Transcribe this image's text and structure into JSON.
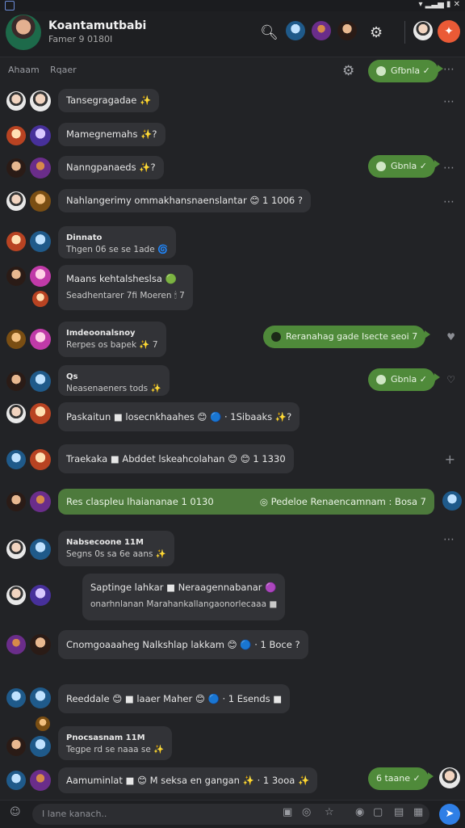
{
  "status": {
    "right": "▾ ▂▃▅ ▮ ✕"
  },
  "header": {
    "title": "Koantamutbabi",
    "subtitle": "Famer 9 0180I",
    "cta_icon": "ghost-icon"
  },
  "toolbar": {
    "left_label": "Ahaam",
    "right_label": "Rqaer"
  },
  "pill_top": {
    "label": "Gfbnla ✓"
  },
  "messages": [
    {
      "text": "Tansegragadae ✨"
    },
    {
      "text": "Mamegnemahs ✨?"
    },
    {
      "text": "Nanngpanaeds ✨?",
      "reply": "Gbnla ✓"
    },
    {
      "text": "Nahlangerimy ommakhansnaenslantar 😊 1 1006 ?"
    },
    {
      "top": "Dinnato",
      "sub": "Thgen 06 se se 1ade 🌀"
    },
    {
      "text": "Maans kehtalsheslsa 🟢",
      "sub": "Seadhentarer 7fi Moeren 🕯 7"
    },
    {
      "top": "Imdeoonalsnoy",
      "sub": "Rerpes os bapek ✨ 7",
      "reply": "Reranahag gade Isecte seoi 7"
    },
    {
      "top": "Qs",
      "sub": "Neasenaeners tods ✨",
      "reply": "Gbnla ✓"
    },
    {
      "text": "Paskaitun ■ losecnkhaahes 😊 🔵 · 1Sibaaks ✨?"
    },
    {
      "text": "Traekaka ■ Abddet lskeahcolahan 😊 😊 1 1330"
    },
    {
      "text": "Res claspleu lhaiananae 1 0130",
      "right": "◎ Pedeloe Renaencamnam : Bosa 7"
    },
    {
      "top": "Nabsecoone 11M",
      "sub": "Segns 0s sa 6e aans ✨"
    },
    {
      "text": "Saptinge lahkar ■ Neraagennabanar 🟣",
      "sub": "onarhnlanan Marahankallangaonorlecaaa ■"
    },
    {
      "text": "Cnomgoaaaheg Nalkshlap lakkam 😊 🔵 · 1 Boce ?"
    },
    {
      "text": "Reeddale 😊 ■ laaer Maher 😊 🔵 · 1 Esends ■"
    },
    {
      "top": "Pnocsasnam 11M",
      "sub": "Tegpe rd se naaa se ✨"
    },
    {
      "text": "Aamuminlat ■ 😊 M seksa en gangan ✨ · 1 3ooa ✨",
      "reply": "6 taane ✓"
    }
  ],
  "composer": {
    "placeholder": "I lane kanach.."
  }
}
